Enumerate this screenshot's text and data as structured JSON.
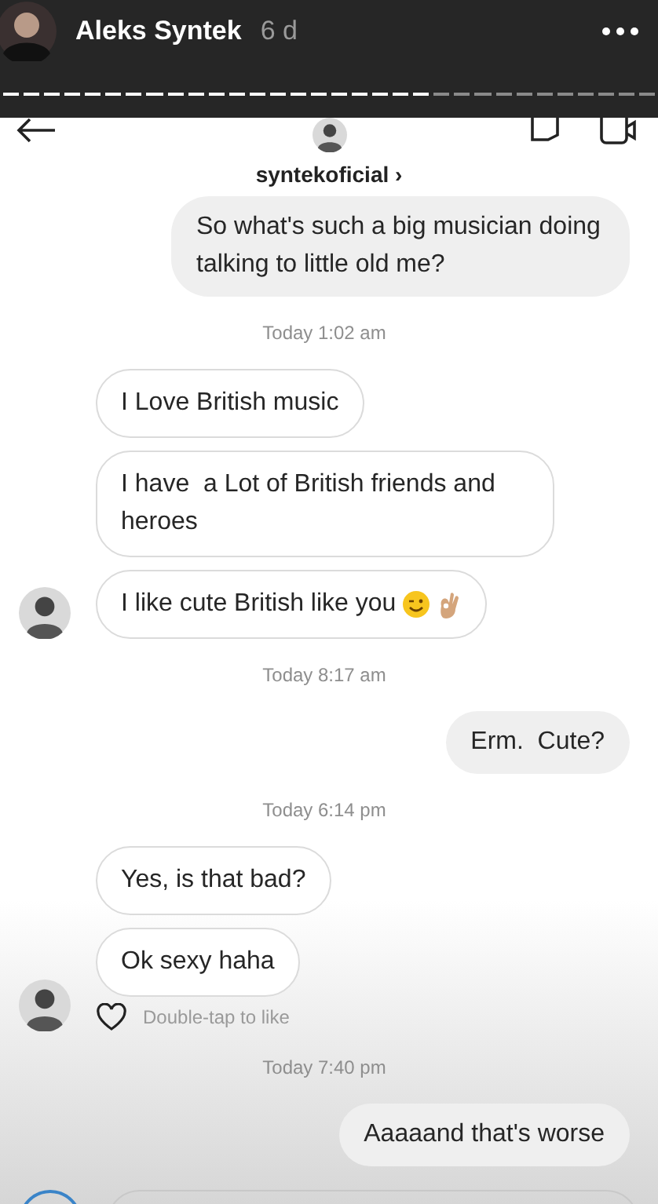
{
  "story": {
    "author": "Aleks Syntek",
    "age": "6 d"
  },
  "progress": [
    {
      "viewed": true
    },
    {
      "viewed": true
    },
    {
      "viewed": true
    },
    {
      "viewed": true
    },
    {
      "viewed": true
    },
    {
      "viewed": true
    },
    {
      "viewed": true
    },
    {
      "viewed": true
    },
    {
      "viewed": true
    },
    {
      "viewed": true
    },
    {
      "viewed": true
    },
    {
      "viewed": true
    },
    {
      "viewed": true
    },
    {
      "viewed": true
    },
    {
      "viewed": true
    },
    {
      "viewed": true
    },
    {
      "viewed": true
    },
    {
      "viewed": true
    },
    {
      "viewed": true
    },
    {
      "viewed": true
    },
    {
      "viewed": true
    },
    {
      "viewed": false
    },
    {
      "viewed": false
    },
    {
      "viewed": false
    },
    {
      "viewed": false
    },
    {
      "viewed": false
    },
    {
      "viewed": false
    },
    {
      "viewed": false
    },
    {
      "viewed": false
    },
    {
      "viewed": false
    },
    {
      "viewed": false
    },
    {
      "viewed": false
    }
  ],
  "chat": {
    "username": "syntekoficial ›"
  },
  "items": [
    {
      "kind": "outgoing",
      "text": "So what's such a big musician doing talking to little old me?"
    },
    {
      "kind": "timestamp",
      "text": "Today 1:02 am"
    },
    {
      "kind": "incoming",
      "messages": [
        {
          "text": "I Love British music"
        },
        {
          "text": "I have  a Lot of British friends and heroes"
        },
        {
          "text": "I like cute British like you",
          "emojis": [
            {
              "kind": "wink"
            },
            {
              "kind": "ok-hand"
            }
          ]
        }
      ]
    },
    {
      "kind": "timestamp",
      "text": "Today 8:17 am"
    },
    {
      "kind": "outgoing",
      "text": "Erm.  Cute?"
    },
    {
      "kind": "timestamp",
      "text": "Today 6:14 pm"
    },
    {
      "kind": "incoming",
      "messages": [
        {
          "text": "Yes, is that bad?"
        },
        {
          "text": "Ok sexy haha"
        }
      ],
      "like_hint": "Double-tap to like"
    },
    {
      "kind": "timestamp",
      "text": "Today 7:40 pm"
    },
    {
      "kind": "outgoing",
      "text": "Aaaaand that's worse"
    }
  ]
}
